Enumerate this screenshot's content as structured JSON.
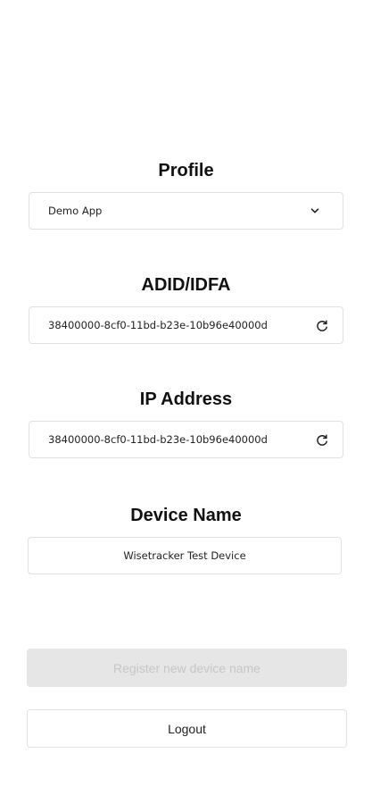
{
  "profile": {
    "title": "Profile",
    "selected_value": "Demo App",
    "icon": "chevron-down-icon"
  },
  "adid": {
    "title": "ADID/IDFA",
    "value": "38400000-8cf0-11bd-b23e-10b96e40000d",
    "icon": "refresh-icon"
  },
  "ip": {
    "title": "IP Address",
    "value": "38400000-8cf0-11bd-b23e-10b96e40000d",
    "icon": "refresh-icon"
  },
  "device": {
    "title": "Device Name",
    "value": "Wisetracker Test Device"
  },
  "actions": {
    "register_label": "Register new device name",
    "logout_label": "Logout"
  },
  "colors": {
    "border": "#e2e2e2",
    "disabled_bg": "#e6e6e6",
    "disabled_text": "#c6c6c6",
    "text": "#111111"
  }
}
